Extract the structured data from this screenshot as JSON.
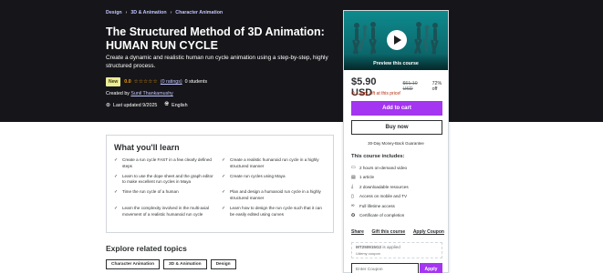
{
  "breadcrumb": [
    "Design",
    "3D & Animation",
    "Character Animation"
  ],
  "course": {
    "title": "The Structured Method of 3D Animation: HUMAN RUN CYCLE",
    "subtitle": "Create a dynamic and realistic human run cycle animation using a step-by-step, highly structured process.",
    "badge": "New",
    "rating": "0.0",
    "stars_filled": 0,
    "ratings_link": "(0 ratings)",
    "students": "0 students",
    "created_by_label": "Created by",
    "instructor": "Sunil Thankamushy",
    "last_updated": "Last updated 9/2025",
    "language": "English"
  },
  "sidebar": {
    "preview_label": "Preview this course",
    "price": "$5.90 USD",
    "original_price": "$61.10 USD",
    "discount": "72% off",
    "timer_bold": "1 day",
    "timer_rest": "left at this price!",
    "add_to_cart": "Add to cart",
    "buy_now": "Buy now",
    "guarantee": "30-Day Money-Back Guarantee",
    "includes_title": "This course includes:",
    "includes": [
      {
        "icon": "video-icon",
        "glyph": "▭",
        "text": "2 hours on-demand video"
      },
      {
        "icon": "article-icon",
        "glyph": "▤",
        "text": "1 article"
      },
      {
        "icon": "download-icon",
        "glyph": "⤓",
        "text": "2 downloadable resources"
      },
      {
        "icon": "mobile-icon",
        "glyph": "▯",
        "text": "Access on mobile and TV"
      },
      {
        "icon": "lifetime-icon",
        "glyph": "∞",
        "text": "Full lifetime access"
      },
      {
        "icon": "certificate-icon",
        "glyph": "✪",
        "text": "Certificate of completion"
      }
    ],
    "share": "Share",
    "gift": "Gift this course",
    "apply_coupon": "Apply Coupon",
    "coupon_code": "MT250915G2",
    "coupon_suffix": "is applied",
    "coupon_sub": "Udemy coupon",
    "coupon_placeholder": "Enter Coupon",
    "apply_button": "Apply"
  },
  "learn": {
    "title": "What you'll learn",
    "items": [
      "Create a run cycle FAST in a few clearly defined steps",
      "Create a realistic humanoid run cycle in a highly structured manner",
      "Learn to use the dope sheet and the graph editor to make excellent run cycles in Maya",
      "Create run cycles using Maya",
      "Time the run cycle of a human",
      "Plan and design a humanoid run cycle in a highly structured manner",
      "Learn the complexity involved in the multi-axial movement of a realistic humanoid run cycle",
      "Learn how to design the run cycle such that it can be easily edited using curves"
    ]
  },
  "explore": {
    "title": "Explore related topics",
    "topics": [
      "Character Animation",
      "3D & Animation",
      "Design"
    ]
  },
  "colors": {
    "hero_bg": "#16161a",
    "accent_purple": "#a435f0",
    "link_purple": "#c0c4fc",
    "star_orange": "#f69c08",
    "badge_yellow": "#eceb98",
    "timer_red": "#b32d0f",
    "preview_teal": "#0e8a8d"
  }
}
